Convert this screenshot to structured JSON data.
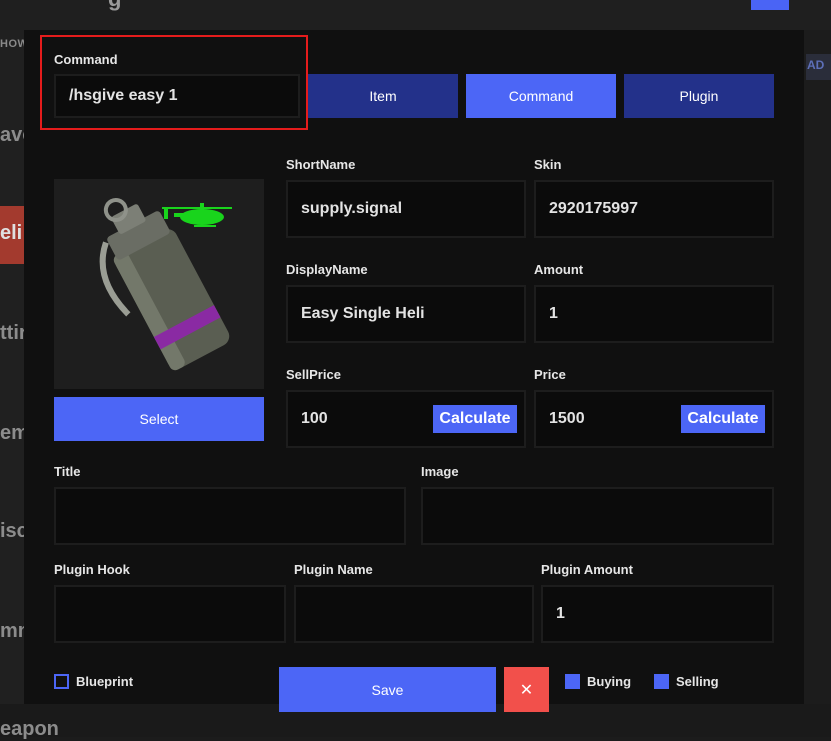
{
  "background": {
    "title_fragment": "g",
    "show_label": "HOW",
    "add_label": "AD",
    "sidebar_items": [
      {
        "label": "avo",
        "active": false
      },
      {
        "label": "eli",
        "active": true
      },
      {
        "label": "ttir",
        "active": false
      },
      {
        "label": "em",
        "active": false
      },
      {
        "label": "isc",
        "active": false
      },
      {
        "label": "mm",
        "active": false
      },
      {
        "label": "eapon",
        "active": false
      }
    ]
  },
  "modal": {
    "command": {
      "label": "Command",
      "value": "/hsgive easy 1"
    },
    "type_tabs": [
      {
        "label": "Item",
        "selected": false
      },
      {
        "label": "Command",
        "selected": true
      },
      {
        "label": "Plugin",
        "selected": false
      }
    ],
    "item_image_icon": "supply-signal-grenade-icon",
    "select_label": "Select",
    "short_name": {
      "label": "ShortName",
      "value": "supply.signal"
    },
    "skin": {
      "label": "Skin",
      "value": "2920175997"
    },
    "display_name": {
      "label": "DisplayName",
      "value": "Easy Single Heli"
    },
    "amount": {
      "label": "Amount",
      "value": "1"
    },
    "sell_price": {
      "label": "SellPrice",
      "value": "100",
      "calculate_label": "Calculate"
    },
    "price": {
      "label": "Price",
      "value": "1500",
      "calculate_label": "Calculate"
    },
    "title": {
      "label": "Title",
      "value": ""
    },
    "image": {
      "label": "Image",
      "value": ""
    },
    "plugin_hook": {
      "label": "Plugin Hook",
      "value": ""
    },
    "plugin_name": {
      "label": "Plugin Name",
      "value": ""
    },
    "plugin_amount": {
      "label": "Plugin Amount",
      "value": "1"
    },
    "blueprint": {
      "label": "Blueprint",
      "checked": false
    },
    "save_label": "Save",
    "close_glyph": "✕",
    "buying": {
      "label": "Buying",
      "checked": true
    },
    "selling": {
      "label": "Selling",
      "checked": true
    }
  },
  "colors": {
    "accent": "#4c66f6",
    "tab_dark": "#23318a",
    "close": "#f2504b",
    "highlight": "#e51c1c",
    "active_category": "#a33a2e"
  }
}
